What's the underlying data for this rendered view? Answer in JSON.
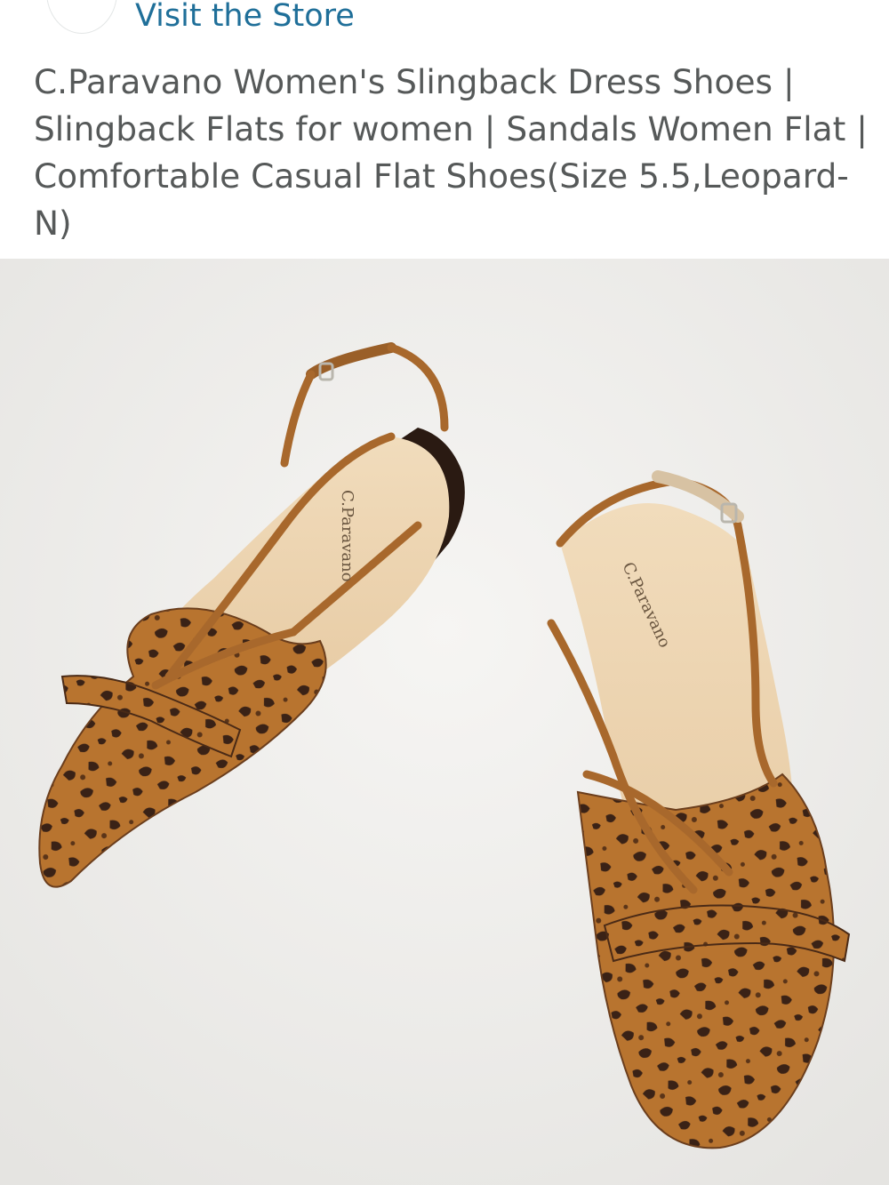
{
  "store": {
    "link_label": "Visit the Store"
  },
  "product": {
    "title": "C.Paravano Women's Slingback Dress Shoes | Slingback Flats for women | Sandals Women Flat | Comfortable Casual Flat Shoes(Size 5.5,Leopard-N)",
    "image": {
      "insole_brand": "C.Paravano",
      "colors": {
        "background": "#efeeec",
        "leopard_base": "#b8742f",
        "leopard_spot": "#3a2216",
        "insole": "#ecd3ad"
      }
    }
  }
}
